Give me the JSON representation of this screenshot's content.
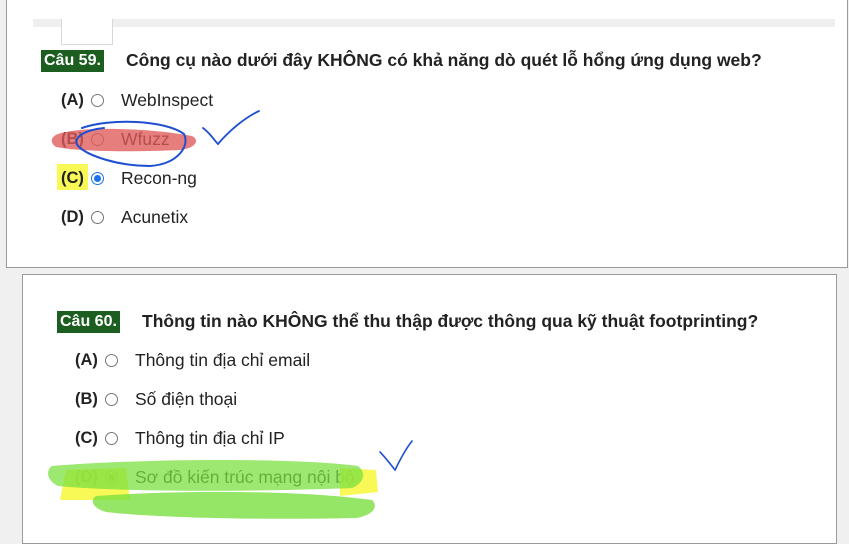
{
  "questions": [
    {
      "number": "Câu 59.",
      "text": "Công cụ nào dưới đây KHÔNG có khả năng dò quét lỗ hổng ứng dụng web?",
      "options": [
        {
          "letter": "(A)",
          "label": "WebInspect",
          "selected": false
        },
        {
          "letter": "(B)",
          "label": "Wfuzz",
          "selected": false
        },
        {
          "letter": "(C)",
          "label": "Recon-ng",
          "selected": true
        },
        {
          "letter": "(D)",
          "label": "Acunetix",
          "selected": false
        }
      ]
    },
    {
      "number": "Câu 60.",
      "text": "Thông tin nào KHÔNG thể thu thập được thông qua kỹ thuật footprinting?",
      "options": [
        {
          "letter": "(A)",
          "label": "Thông tin địa chỉ email",
          "selected": false
        },
        {
          "letter": "(B)",
          "label": "Số điện thoại",
          "selected": false
        },
        {
          "letter": "(C)",
          "label": "Thông tin địa chỉ IP",
          "selected": false
        },
        {
          "letter": "(D)",
          "label": "Sơ đồ kiến trúc mạng nội bộ",
          "selected": true
        }
      ]
    }
  ],
  "colors": {
    "question_badge": "#1b5e20",
    "radio_checked": "#1a73e8",
    "highlight_yellow": "#f7f73a",
    "highlight_red": "#e05a5a",
    "highlight_green": "#7be040",
    "pen_blue": "#1e4fd0"
  }
}
